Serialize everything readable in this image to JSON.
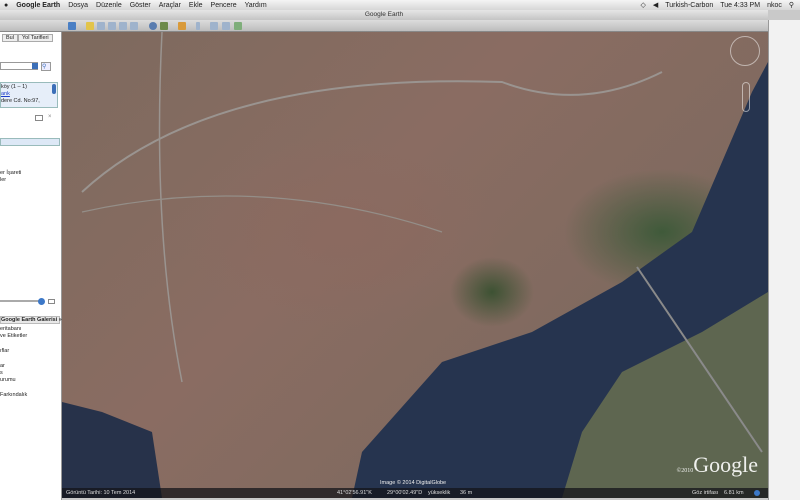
{
  "menubar": {
    "app": "Google Earth",
    "items": [
      "Dosya",
      "Düzenle",
      "Göster",
      "Araçlar",
      "Ekle",
      "Pencere",
      "Yardım"
    ],
    "status": {
      "input": "Turkish-Carbon",
      "clock": "Tue 4:33 PM",
      "user": "nkoc"
    }
  },
  "window": {
    "title": "Google Earth"
  },
  "sidebar": {
    "tabs": [
      "Bul",
      "Yol Tarifleri"
    ],
    "search_result": {
      "title": "köy (1 – 1)",
      "link": "ank",
      "address": "dere Cd. No:97,"
    },
    "places": [
      "er İşareti",
      "ler"
    ],
    "layers_header": "Google Earth Galerisi »",
    "layers": [
      "eritabanı",
      "ve Etiketler",
      "ıflar",
      "ar",
      "s",
      "urumu",
      "Farkındalık"
    ]
  },
  "map": {
    "imagery_credit": "Image © 2014 DigitalGlobe",
    "logo": "Google",
    "logo_copyright": "©2010"
  },
  "statusbar": {
    "imagery_date": "Görüntü Tarihi: 10 Tem 2014",
    "lat": "41°02'56.91\"K",
    "lon": "29°00'02.49\"D",
    "elevation_label": "yükseklik",
    "elevation": "36 m",
    "eye_label": "Göz irtifası",
    "eye_alt": "6.81 km"
  }
}
